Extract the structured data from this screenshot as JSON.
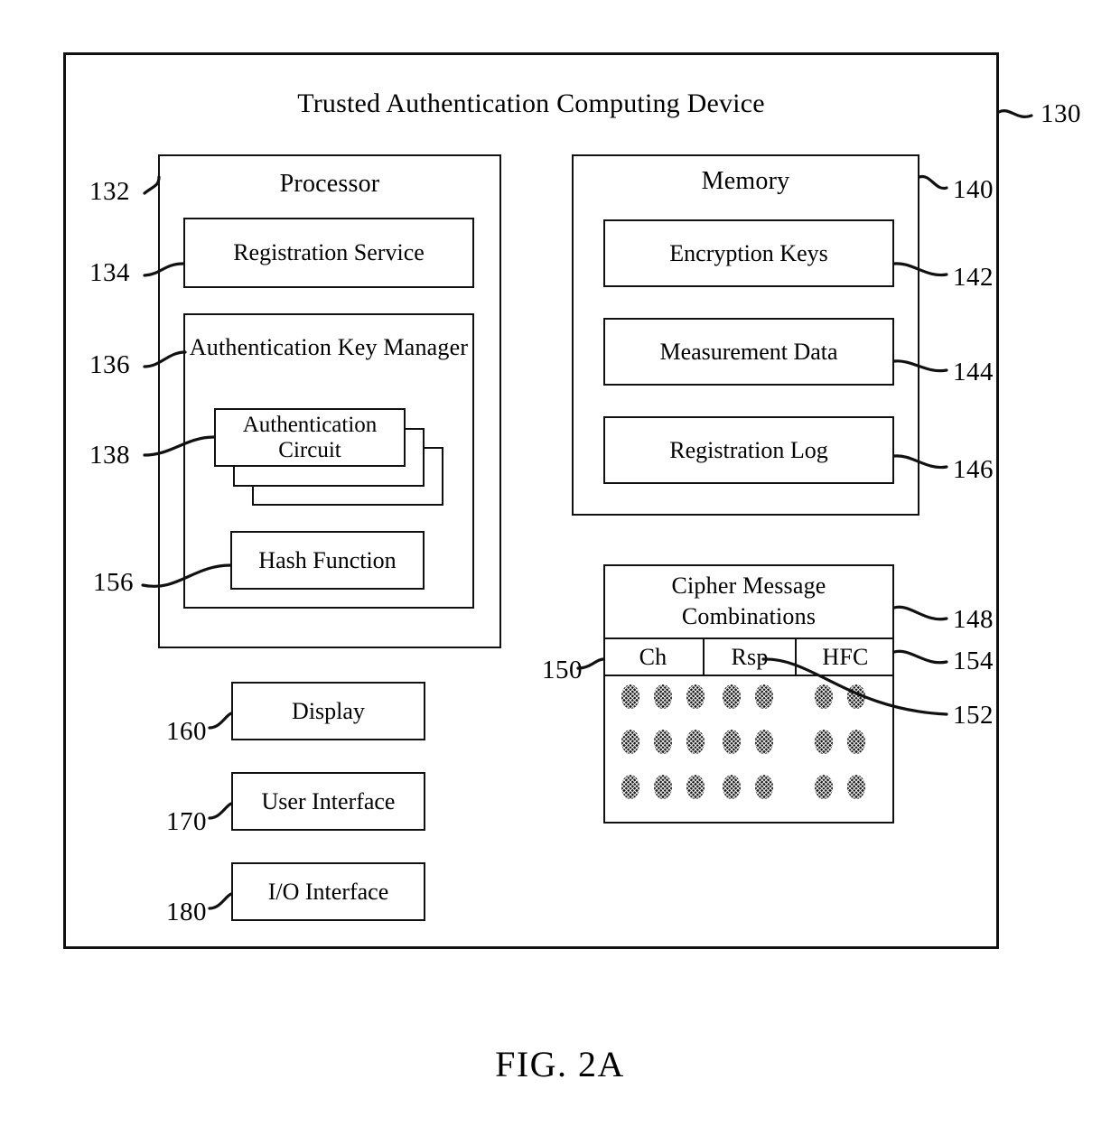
{
  "figure": {
    "caption": "FIG. 2A",
    "outer": {
      "title": "Trusted Authentication Computing Device",
      "ref": "130"
    }
  },
  "processor": {
    "title": "Processor",
    "ref": "132",
    "registration_service": {
      "label": "Registration Service",
      "ref": "134"
    },
    "auth_key_manager": {
      "label": "Authentication Key Manager",
      "ref": "136",
      "auth_circuit": {
        "label": "Authentication Circuit",
        "ref": "138",
        "stack_count": 3
      },
      "hash_function": {
        "label": "Hash Function",
        "ref": "156"
      }
    }
  },
  "memory": {
    "title": "Memory",
    "ref": "140",
    "items": [
      {
        "label": "Encryption Keys",
        "ref": "142"
      },
      {
        "label": "Measurement Data",
        "ref": "144"
      },
      {
        "label": "Registration Log",
        "ref": "146"
      }
    ]
  },
  "peripherals": [
    {
      "label": "Display",
      "ref": "160"
    },
    {
      "label": "User Interface",
      "ref": "170"
    },
    {
      "label": "I/O Interface",
      "ref": "180"
    }
  ],
  "cipher_table": {
    "title_line1": "Cipher Message",
    "title_line2": "Combinations",
    "ref_title": "148",
    "ref_header": "154",
    "ref_body": "150",
    "ref_dot": "152",
    "columns": [
      {
        "label": "Ch",
        "dots_per_row": 3
      },
      {
        "label": "Rsp",
        "dots_per_row": 2
      },
      {
        "label": "HFC",
        "dots_per_row": 2
      }
    ],
    "rows": 3
  },
  "colors": {
    "line": "#111111",
    "background": "#ffffff",
    "dot": "#1a1a1a"
  }
}
